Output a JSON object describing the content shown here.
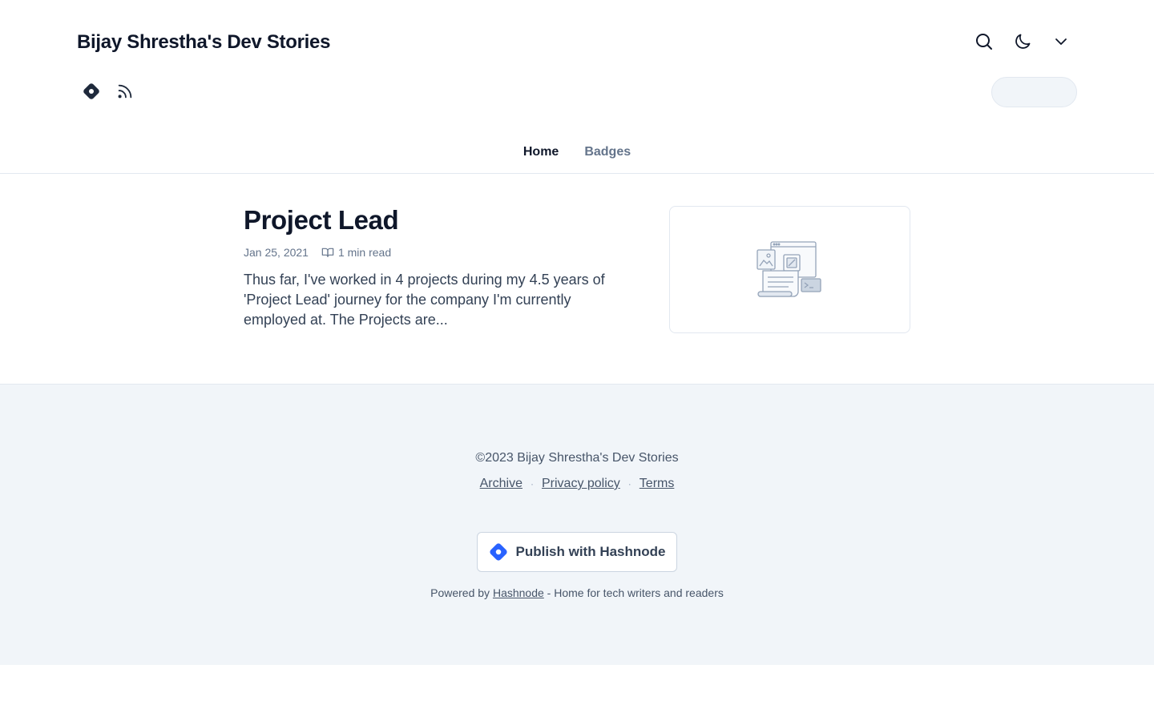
{
  "header": {
    "blog_title": "Bijay Shrestha's Dev Stories",
    "actions": [
      {
        "icon": "search-icon"
      },
      {
        "icon": "moon-icon"
      },
      {
        "icon": "chevron-down-icon"
      }
    ],
    "social": [
      {
        "icon": "hashnode-icon"
      },
      {
        "icon": "rss-icon"
      }
    ]
  },
  "nav": {
    "items": [
      {
        "label": "Home",
        "active": true
      },
      {
        "label": "Badges",
        "active": false
      }
    ]
  },
  "posts": [
    {
      "title": "Project Lead",
      "date": "Jan 25, 2021",
      "read_time": "1 min read",
      "excerpt": "Thus far, I've worked in 4 projects during my 4.5 years of 'Project Lead' journey for the company I'm currently employed at. The Projects are...",
      "cover_icon": "cover-placeholder-illustration"
    }
  ],
  "footer": {
    "copyright": "©2023 Bijay Shrestha's Dev Stories",
    "links": [
      "Archive",
      "Privacy policy",
      "Terms"
    ],
    "publish_label": "Publish with Hashnode",
    "powered_prefix": "Powered by",
    "powered_link": "Hashnode",
    "powered_suffix": "- Home for tech writers and readers"
  },
  "colors": {
    "brand": "#2962ff",
    "text": "#0f172a",
    "muted": "#64748b",
    "footer_bg": "#f1f5f9"
  }
}
